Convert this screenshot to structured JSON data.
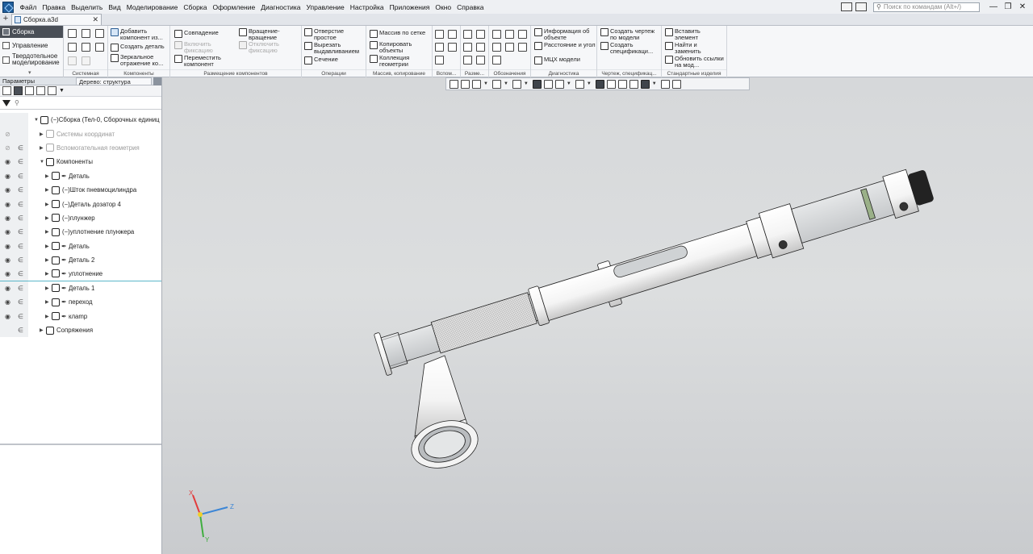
{
  "menu": [
    "Файл",
    "Правка",
    "Выделить",
    "Вид",
    "Моделирование",
    "Сборка",
    "Оформление",
    "Диагностика",
    "Управление",
    "Настройка",
    "Приложения",
    "Окно",
    "Справка"
  ],
  "search": {
    "placeholder": "Поиск по командам (Alt+/)"
  },
  "window_controls": {
    "minimize": "—",
    "restore": "❐",
    "close": "✕"
  },
  "document_tab": {
    "title": "Сборка.a3d",
    "close": "✕",
    "add": "+"
  },
  "ribbon": {
    "modes": [
      {
        "label": "Сборка",
        "active": true
      },
      {
        "label": "Управление",
        "active": false
      },
      {
        "label": "Твердотельное моделирование",
        "active": false
      }
    ],
    "groups": {
      "system": "Системная",
      "components": "Компоненты",
      "placement": "Размещение компонентов",
      "operations": "Операции",
      "arrays": "Массив, копирование",
      "auxiliary": "Вспом...",
      "dimensions": "Разме...",
      "designations": "Обозначения",
      "diagnostics": "Диагностика",
      "drawing": "Чертеж, спецификац...",
      "standard": "Стандартные изделия"
    },
    "buttons": {
      "add_component": "Добавить компонент из...",
      "create_part": "Создать деталь",
      "mirror": "Зеркальное отражение ко...",
      "coincidence": "Совпадение",
      "enable_fix": "Включить фиксацию",
      "move_component": "Переместить компонент",
      "rotation": "Вращение-вращение",
      "disable_fix": "Отключить фиксацию",
      "hole_simple": "Отверстие простое",
      "cut_extrude": "Вырезать выдавливанием",
      "section": "Сечение",
      "array_grid": "Массив по сетке",
      "copy_objects": "Копировать объекты",
      "geometry_collection": "Коллекция геометрии",
      "object_info": "Информация об объекте",
      "distance_angle": "Расстояние и угол",
      "mass_props": "МЦХ модели",
      "create_drawing": "Создать чертеж по модели",
      "create_spec": "Создать спецификаци...",
      "insert_element": "Вставить элемент",
      "find_replace": "Найти и заменить",
      "update_links": "Обновить ссылки на мод..."
    }
  },
  "panel": {
    "tabs": [
      "Параметры",
      "Дерево: структура"
    ]
  },
  "tree": [
    {
      "label": "(−)Сборка (Тел-0, Сборочных единиц",
      "indent": 0,
      "eye": "",
      "elem": "",
      "icon": "assembly",
      "grey": false,
      "pin": false
    },
    {
      "label": "Системы координат",
      "indent": 1,
      "eye": "hidden",
      "elem": "",
      "icon": "coords",
      "grey": true,
      "pin": false
    },
    {
      "label": "Вспомогательная геометрия",
      "indent": 1,
      "eye": "hidden",
      "elem": "∈",
      "icon": "aux",
      "grey": true,
      "pin": false
    },
    {
      "label": "Компоненты",
      "indent": 1,
      "eye": "visible",
      "elem": "∈",
      "icon": "components",
      "grey": false,
      "pin": false
    },
    {
      "label": "Деталь",
      "indent": 2,
      "eye": "visible",
      "elem": "∈",
      "icon": "part",
      "grey": false,
      "pin": true
    },
    {
      "label": "(−)Шток пневмоцилиндра",
      "indent": 2,
      "eye": "visible",
      "elem": "∈",
      "icon": "part",
      "grey": false,
      "pin": false
    },
    {
      "label": "(−)Деталь дозатор 4",
      "indent": 2,
      "eye": "visible",
      "elem": "∈",
      "icon": "part",
      "grey": false,
      "pin": false
    },
    {
      "label": "(−)плунжер",
      "indent": 2,
      "eye": "visible",
      "elem": "∈",
      "icon": "part",
      "grey": false,
      "pin": false
    },
    {
      "label": "(−)уплотнение плунжера",
      "indent": 2,
      "eye": "visible",
      "elem": "∈",
      "icon": "part",
      "grey": false,
      "pin": false
    },
    {
      "label": "Деталь",
      "indent": 2,
      "eye": "visible",
      "elem": "∈",
      "icon": "part",
      "grey": false,
      "pin": true
    },
    {
      "label": "Деталь 2",
      "indent": 2,
      "eye": "visible",
      "elem": "∈",
      "icon": "part",
      "grey": false,
      "pin": true
    },
    {
      "label": "уплотнение",
      "indent": 2,
      "eye": "visible",
      "elem": "∈",
      "icon": "part",
      "grey": false,
      "pin": true
    },
    {
      "label": "Деталь 1",
      "indent": 2,
      "eye": "visible",
      "elem": "∈",
      "icon": "part",
      "grey": false,
      "pin": true
    },
    {
      "label": "переход",
      "indent": 2,
      "eye": "visible",
      "elem": "∈",
      "icon": "part",
      "grey": false,
      "pin": true
    },
    {
      "label": "клamp",
      "indent": 2,
      "eye": "visible",
      "elem": "∈",
      "icon": "part",
      "grey": false,
      "pin": true
    },
    {
      "label": "Сопряжения",
      "indent": 1,
      "eye": "",
      "elem": "∈",
      "icon": "mates",
      "grey": false,
      "pin": false
    }
  ],
  "axes": {
    "x": "X",
    "y": "Y",
    "z": "Z"
  },
  "icons": {
    "eye": "eye-icon",
    "hidden": "eye-crossed-icon",
    "element": "element-of-icon",
    "filter": "filter-icon",
    "search": "search-icon",
    "gear": "gear-icon",
    "pin": "pin-icon"
  },
  "colors": {
    "accent": "#4a4f57",
    "highlight_line": "#5bb7c9",
    "axis_x": "#e23b3b",
    "axis_y": "#3fae3f",
    "axis_z": "#3c86d6"
  }
}
